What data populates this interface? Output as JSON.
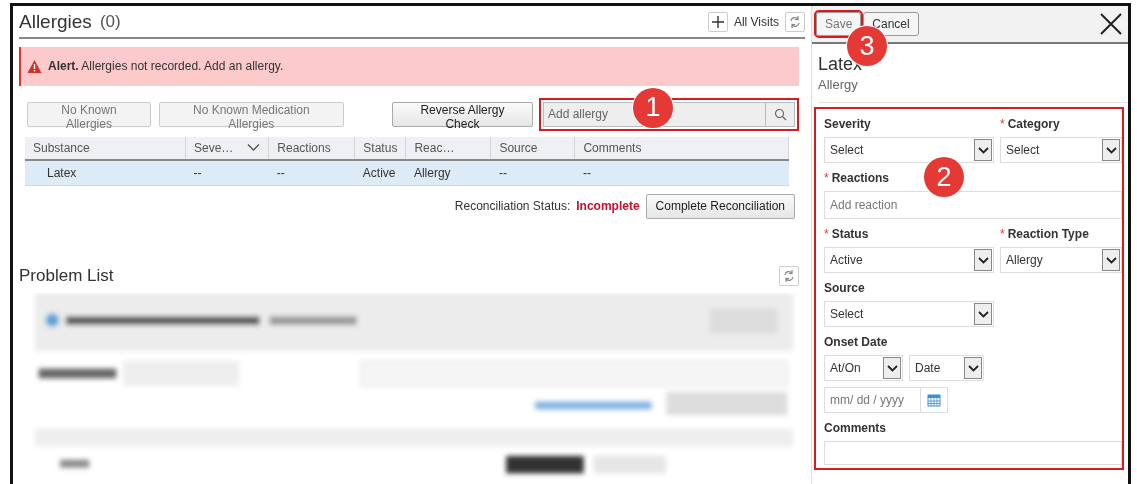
{
  "allergies": {
    "title": "Allergies",
    "count": "(0)",
    "visits": "All Visits"
  },
  "alert": {
    "label": "Alert.",
    "message": "Allergies not recorded. Add an allergy."
  },
  "actions": [
    {
      "label": "No Known Allergies",
      "disabled": true
    },
    {
      "label": "No Known Medication Allergies",
      "disabled": true
    },
    {
      "label": "Reverse Allergy Check",
      "disabled": false
    }
  ],
  "search": {
    "placeholder": "Add allergy",
    "highlighted": true,
    "callout": "1"
  },
  "table": {
    "columns": [
      {
        "label": "Substance",
        "sortable": false
      },
      {
        "label": "Seve…",
        "sortable": true
      },
      {
        "label": "Reactions",
        "sortable": false
      },
      {
        "label": "Status",
        "sortable": false
      },
      {
        "label": "Reac…",
        "sortable": false
      },
      {
        "label": "Source",
        "sortable": false
      },
      {
        "label": "Comments",
        "sortable": false
      }
    ],
    "rows": [
      {
        "selected": true,
        "cells": [
          "Latex",
          "--",
          "--",
          "Active",
          "Allergy",
          "--",
          "--"
        ]
      }
    ]
  },
  "reconciliation": {
    "label": "Reconciliation Status:",
    "status": "Incomplete",
    "button": "Complete Reconciliation"
  },
  "problem_list": {
    "title": "Problem List"
  },
  "panel": {
    "buttons": [
      {
        "label": "Save",
        "highlighted": true,
        "callout": "3"
      },
      {
        "label": "Cancel",
        "highlighted": false
      }
    ],
    "title": "Latex",
    "subtitle": "Allergy",
    "form": {
      "highlighted": true,
      "callout": "2",
      "fields": [
        {
          "kind": "select",
          "label": "Severity",
          "value": "Select"
        },
        {
          "kind": "select",
          "required_mark": "*",
          "label": "Category",
          "value": "Select"
        },
        {
          "kind": "text",
          "required_mark": "*",
          "label": "Reactions",
          "placeholder": "Add reaction"
        },
        {
          "kind": "select",
          "required_mark": "*",
          "label": "Status",
          "value": "Active"
        },
        {
          "kind": "select",
          "required_mark": "*",
          "label": "Reaction Type",
          "value": "Allergy"
        },
        {
          "kind": "select",
          "label": "Source",
          "value": "Select"
        },
        {
          "kind": "date",
          "label": "Onset Date",
          "options": [
            "At/On",
            "Date"
          ],
          "placeholder": "mm/ dd / yyyy"
        },
        {
          "kind": "textarea",
          "label": "Comments"
        }
      ]
    }
  }
}
